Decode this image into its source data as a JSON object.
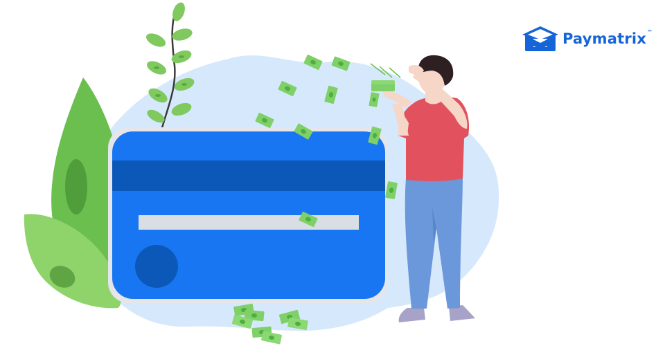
{
  "brand": {
    "name": "Paymatrix",
    "trademark": "™",
    "icon": "graduation-cap-box-logo"
  },
  "colors": {
    "brand": "#1565d8",
    "card": "#1976f2",
    "card_stripe": "#0b58b8",
    "blob": "#d6e8fb",
    "leaf_light": "#8fd46a",
    "leaf_dark": "#6bbf4f",
    "money": "#7fd068",
    "shirt": "#e2525e",
    "jeans": "#6b97db",
    "hair": "#2e1f23",
    "skin": "#f6d6c6"
  },
  "illustration": {
    "objects": [
      "credit-card",
      "person-throwing-money",
      "money-bills",
      "plant-vine",
      "leaf-plant",
      "background-blob"
    ]
  }
}
